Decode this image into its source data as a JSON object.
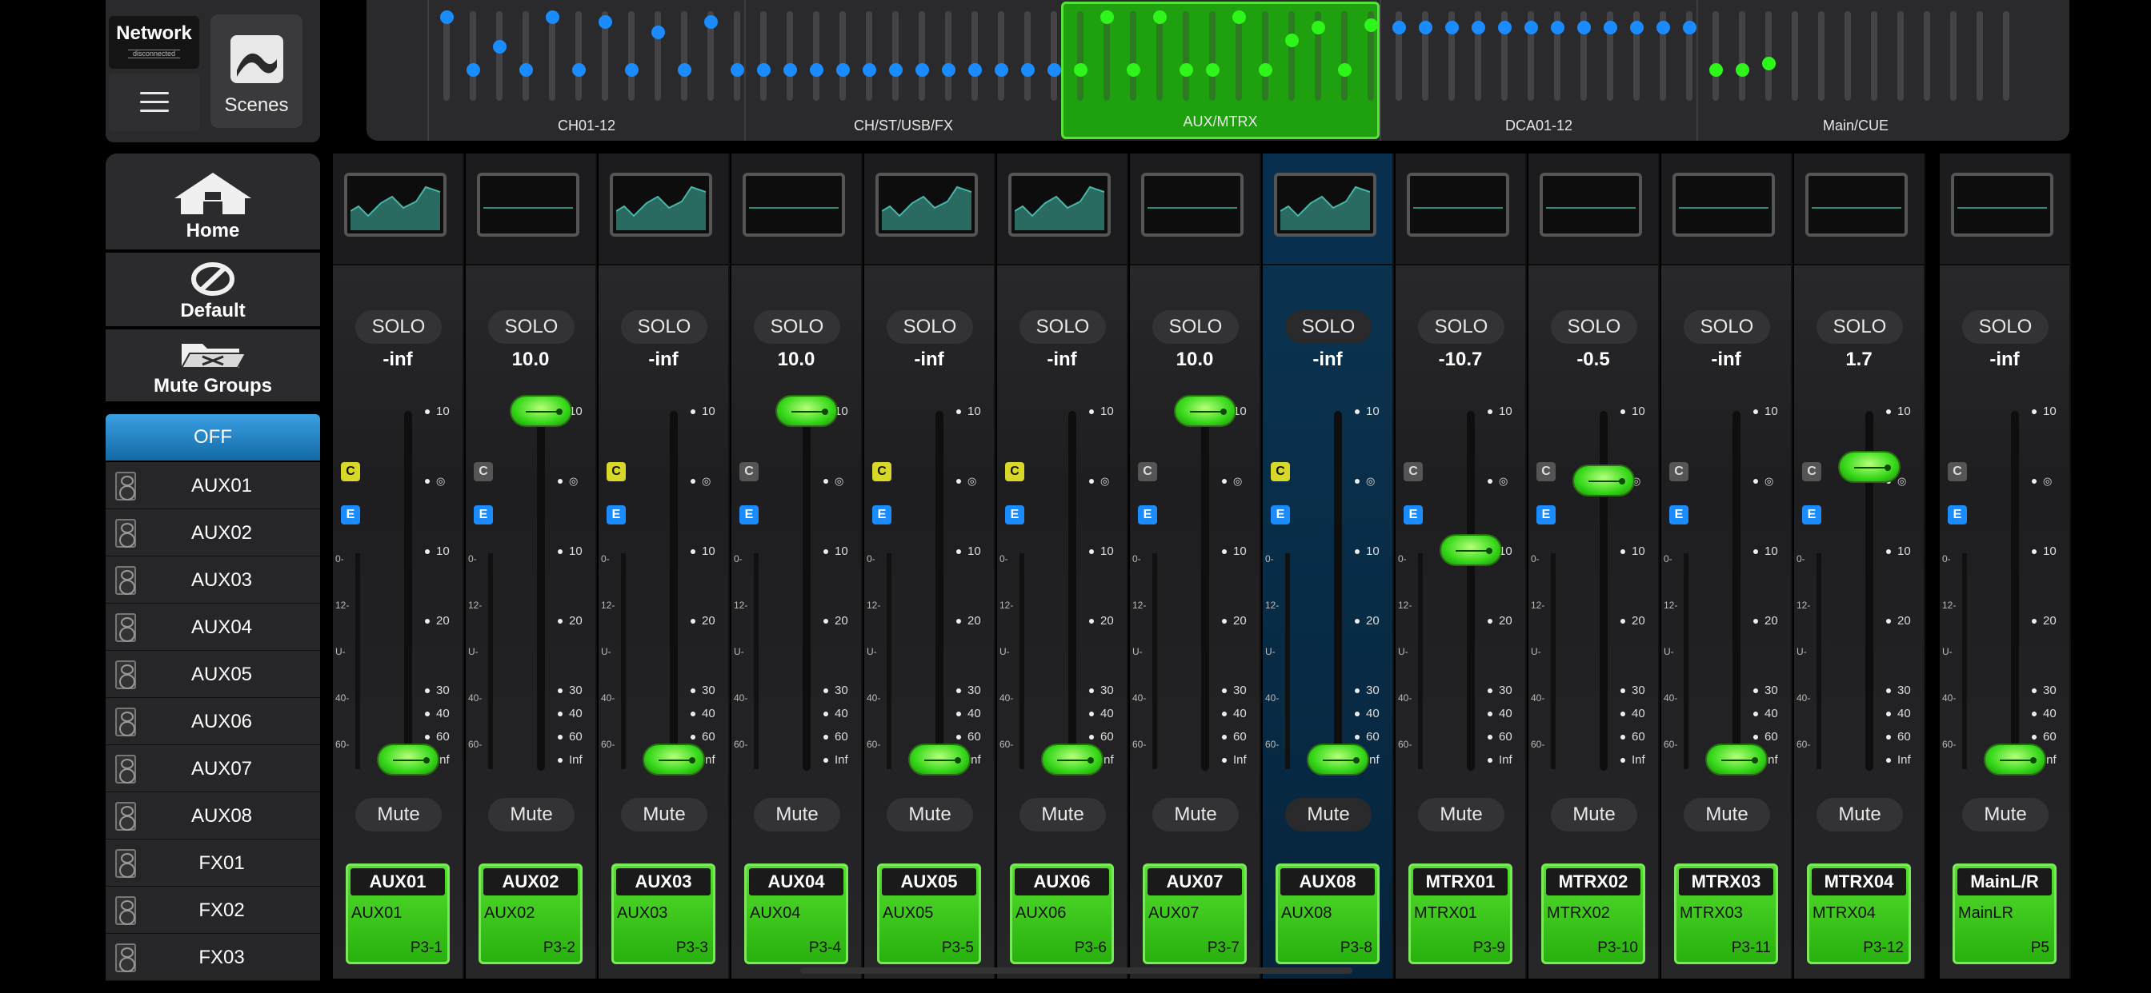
{
  "top_panel": {
    "network_title": "Network",
    "network_status": "disconnected",
    "scenes_label": "Scenes"
  },
  "overview": {
    "groups": [
      {
        "label": "CH01-12",
        "active": false
      },
      {
        "label": "CH/ST/USB/FX",
        "active": false
      },
      {
        "label": "AUX/MTRX",
        "active": true
      },
      {
        "label": "DCA01-12",
        "active": false
      },
      {
        "label": "Main/CUE",
        "active": false
      }
    ]
  },
  "sidebar": {
    "home_label": "Home",
    "default_label": "Default",
    "mute_groups_label": "Mute Groups",
    "off_label": "OFF",
    "items": [
      {
        "label": "AUX01",
        "icon": "speaker-icon"
      },
      {
        "label": "AUX02",
        "icon": "speaker-icon"
      },
      {
        "label": "AUX03",
        "icon": "speaker-icon"
      },
      {
        "label": "AUX04",
        "icon": "speaker-icon"
      },
      {
        "label": "AUX05",
        "icon": "speaker-icon"
      },
      {
        "label": "AUX06",
        "icon": "speaker-icon"
      },
      {
        "label": "AUX07",
        "icon": "speaker-icon"
      },
      {
        "label": "AUX08",
        "icon": "speaker-icon"
      },
      {
        "label": "FX01",
        "icon": "speaker-icon"
      },
      {
        "label": "FX02",
        "icon": "speaker-icon"
      },
      {
        "label": "FX03",
        "icon": "speaker-icon"
      }
    ]
  },
  "scale_labels": [
    "10",
    "10",
    "10",
    "20",
    "30",
    "40",
    "60",
    "Inf"
  ],
  "meter_labels": [
    "0-",
    "12-",
    "U-",
    "40-",
    "60-"
  ],
  "solo_label": "SOLO",
  "mute_label": "Mute",
  "badge_c": "C",
  "badge_e": "E",
  "strips": [
    {
      "id": "AUX01",
      "name": "AUX01",
      "pos": "P3-1",
      "gain": "-inf",
      "level": 0.0,
      "c_on": true,
      "eq": true,
      "selected": false
    },
    {
      "id": "AUX02",
      "name": "AUX02",
      "pos": "P3-2",
      "gain": "10.0",
      "level": 1.0,
      "c_on": false,
      "eq": false,
      "selected": false
    },
    {
      "id": "AUX03",
      "name": "AUX03",
      "pos": "P3-3",
      "gain": "-inf",
      "level": 0.0,
      "c_on": true,
      "eq": true,
      "selected": false
    },
    {
      "id": "AUX04",
      "name": "AUX04",
      "pos": "P3-4",
      "gain": "10.0",
      "level": 1.0,
      "c_on": false,
      "eq": false,
      "selected": false
    },
    {
      "id": "AUX05",
      "name": "AUX05",
      "pos": "P3-5",
      "gain": "-inf",
      "level": 0.0,
      "c_on": true,
      "eq": true,
      "selected": false
    },
    {
      "id": "AUX06",
      "name": "AUX06",
      "pos": "P3-6",
      "gain": "-inf",
      "level": 0.0,
      "c_on": true,
      "eq": true,
      "selected": false
    },
    {
      "id": "AUX07",
      "name": "AUX07",
      "pos": "P3-7",
      "gain": "10.0",
      "level": 1.0,
      "c_on": false,
      "eq": false,
      "selected": false
    },
    {
      "id": "AUX08",
      "name": "AUX08",
      "pos": "P3-8",
      "gain": "-inf",
      "level": 0.0,
      "c_on": true,
      "eq": true,
      "selected": true
    },
    {
      "id": "MTRX01",
      "name": "MTRX01",
      "pos": "P3-9",
      "gain": "-10.7",
      "level": 0.6,
      "c_on": false,
      "eq": false,
      "selected": false
    },
    {
      "id": "MTRX02",
      "name": "MTRX02",
      "pos": "P3-10",
      "gain": "-0.5",
      "level": 0.8,
      "c_on": false,
      "eq": false,
      "selected": false
    },
    {
      "id": "MTRX03",
      "name": "MTRX03",
      "pos": "P3-11",
      "gain": "-inf",
      "level": 0.0,
      "c_on": false,
      "eq": false,
      "selected": false
    },
    {
      "id": "MTRX04",
      "name": "MTRX04",
      "pos": "P3-12",
      "gain": "1.7",
      "level": 0.84,
      "c_on": false,
      "eq": false,
      "selected": false
    },
    {
      "id": "MainL/R",
      "name": "MainLR",
      "pos": "P5",
      "gain": "-inf",
      "level": 0.0,
      "c_on": false,
      "eq": false,
      "selected": false
    }
  ]
}
